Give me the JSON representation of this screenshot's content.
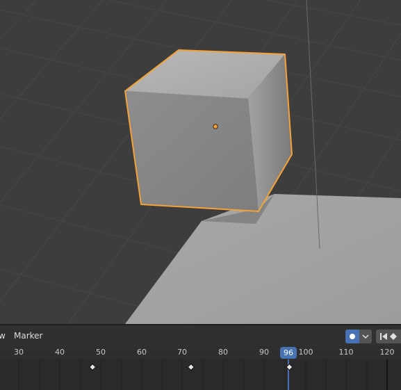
{
  "timeline": {
    "menu": [
      "w",
      "Marker"
    ],
    "frame_ticks": [
      "30",
      "40",
      "50",
      "60",
      "70",
      "80",
      "90",
      "100",
      "110",
      "120"
    ],
    "current_frame": "96",
    "keyframes": [
      48,
      72,
      96
    ]
  },
  "viewport": {
    "selected_object": "Cube"
  },
  "colors": {
    "selection_outline": "#f5a236",
    "accent": "#4772b3"
  }
}
